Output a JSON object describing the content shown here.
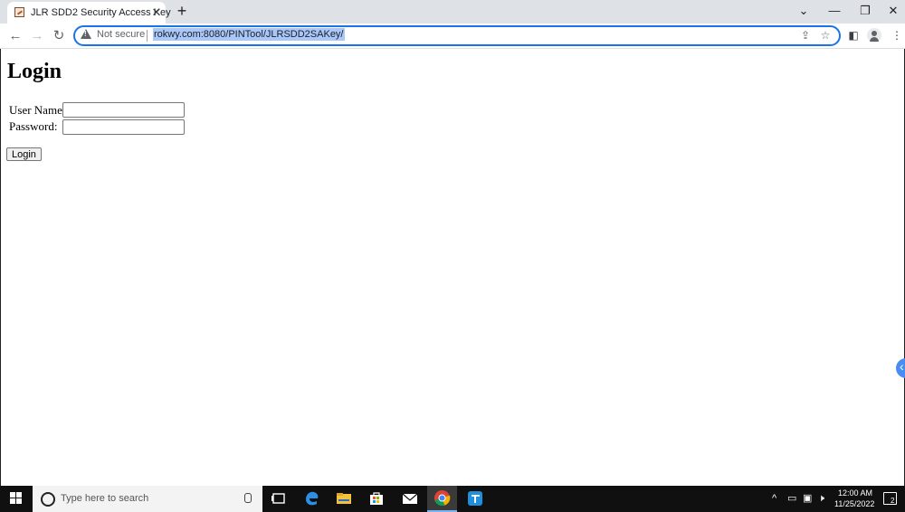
{
  "browser": {
    "tab_title": "JLR SDD2 Security Access Key",
    "tab_close": "✕",
    "new_tab": "+",
    "security_label": "Not secure",
    "url": "rokwy.com:8080/PINTool/JLRSDD2SAKey/"
  },
  "page": {
    "heading": "Login",
    "username_label": "User Name:",
    "password_label": "Password:",
    "username_value": "",
    "password_value": "",
    "login_button": "Login"
  },
  "taskbar": {
    "search_placeholder": "Type here to search",
    "time": "12:00 AM",
    "date": "11/25/2022",
    "notification_count": "2"
  },
  "colors": {
    "accent": "#1a73e8",
    "url_highlight": "#a8c7fa",
    "taskbar": "#101010"
  }
}
